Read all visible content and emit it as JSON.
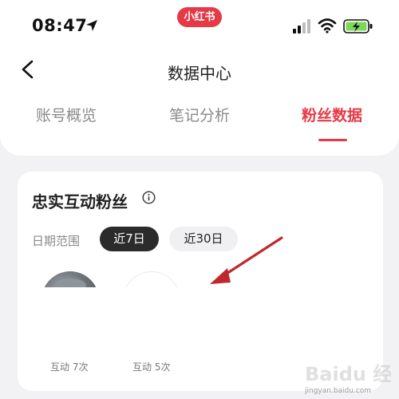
{
  "status_bar": {
    "time": "08:47",
    "app_badge": "小红书",
    "icons": [
      "location-arrow-icon",
      "signal-icon",
      "wifi-icon",
      "battery-charging-icon"
    ]
  },
  "nav": {
    "title": "数据中心",
    "back_icon": "chevron-left-icon"
  },
  "tabs": [
    {
      "label": "账号概览",
      "active": false
    },
    {
      "label": "笔记分析",
      "active": false
    },
    {
      "label": "粉丝数据",
      "active": true
    }
  ],
  "card": {
    "title": "忠实互动粉丝",
    "info_icon": "info-icon",
    "date_range_label": "日期范围",
    "chips": [
      {
        "label": "近7日",
        "active": true
      },
      {
        "label": "近30日",
        "active": false
      }
    ],
    "fans": [
      {
        "interaction": "互动 7次"
      },
      {
        "interaction": "互动 5次"
      }
    ]
  },
  "watermark": {
    "text": "Baidu 经验",
    "sub": "jingyan.baidu.com"
  },
  "colors": {
    "accent": "#e63946",
    "chip_active_bg": "#2b2b2b",
    "page_bg": "#f2f2f4",
    "arrow": "#c0282d"
  }
}
